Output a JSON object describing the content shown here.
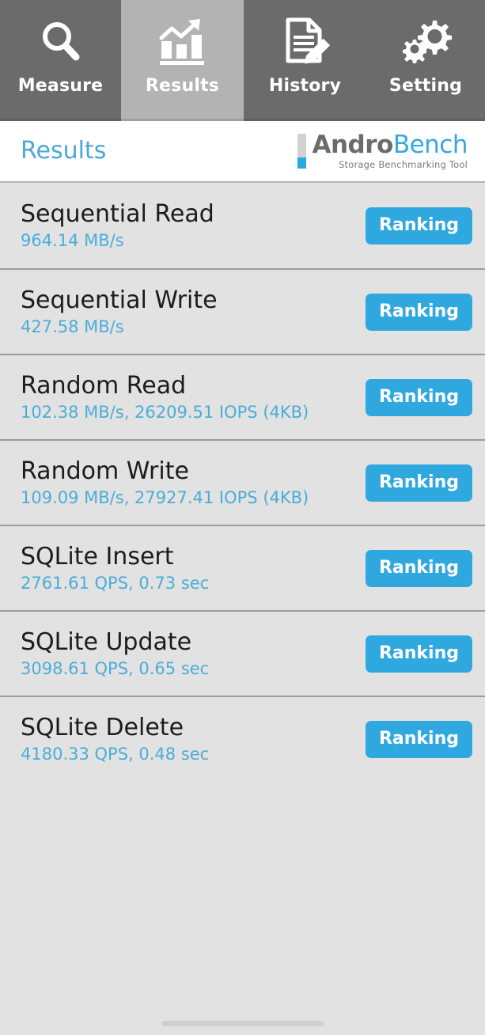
{
  "app": {
    "name": "AndroBench",
    "tagline": "Storage Benchmarking Tool",
    "logo_andro": "Andro",
    "logo_bench": "Bench"
  },
  "theme": {
    "accent_blue": "#2fa8e0",
    "value_blue": "#4aadd8",
    "title_blue": "#4aa8d8",
    "tab_inactive_bg": "#6b6b6b",
    "tab_active_bg": "#b3b3b3",
    "list_bg": "#e2e2e2",
    "divider": "#9c9c9c",
    "header_bg": "#ffffff",
    "row_title": "#1c1c1c"
  },
  "tabs": [
    {
      "label": "Measure",
      "icon": "magnifier-icon",
      "active": false
    },
    {
      "label": "Results",
      "icon": "bar-chart-arrow-icon",
      "active": true
    },
    {
      "label": "History",
      "icon": "document-pencil-icon",
      "active": false
    },
    {
      "label": "Setting",
      "icon": "gears-icon",
      "active": false
    }
  ],
  "header": {
    "title": "Results"
  },
  "results": {
    "button_label": "Ranking",
    "rows": [
      {
        "title": "Sequential Read",
        "value": "964.14 MB/s"
      },
      {
        "title": "Sequential Write",
        "value": "427.58 MB/s"
      },
      {
        "title": "Random Read",
        "value": "102.38 MB/s, 26209.51 IOPS (4KB)"
      },
      {
        "title": "Random Write",
        "value": "109.09 MB/s, 27927.41 IOPS (4KB)"
      },
      {
        "title": "SQLite Insert",
        "value": "2761.61 QPS, 0.73 sec"
      },
      {
        "title": "SQLite Update",
        "value": "3098.61 QPS, 0.65 sec"
      },
      {
        "title": "SQLite Delete",
        "value": "4180.33 QPS, 0.48 sec"
      }
    ]
  }
}
